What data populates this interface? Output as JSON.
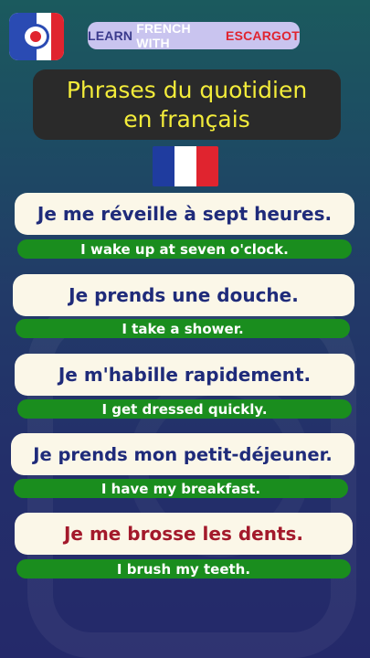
{
  "brand": {
    "word1": "LEARN",
    "word2": "FRENCH WITH",
    "word3": "ESCARGOT"
  },
  "title": {
    "line1": "Phrases du quotidien",
    "line2": "en français"
  },
  "flag": {
    "colors": [
      "#1f3c9f",
      "#ffffff",
      "#e0242f"
    ]
  },
  "phrases": [
    {
      "fr": "Je me réveille à sept heures.",
      "en": "I wake up at seven o'clock."
    },
    {
      "fr": "Je prends une douche.",
      "en": "I take a shower."
    },
    {
      "fr": "Je m'habille rapidement.",
      "en": "I get dressed quickly."
    },
    {
      "fr": "Je prends mon petit-déjeuner.",
      "en": "I have my breakfast."
    },
    {
      "fr": "Je me brosse les dents.",
      "en": "I brush my teeth."
    }
  ],
  "colors": {
    "phrase_text": "#1f2b7a",
    "highlight_text": "#a3192b",
    "translation_bg": "#1a8d1e",
    "title_text": "#f3ec3a"
  }
}
